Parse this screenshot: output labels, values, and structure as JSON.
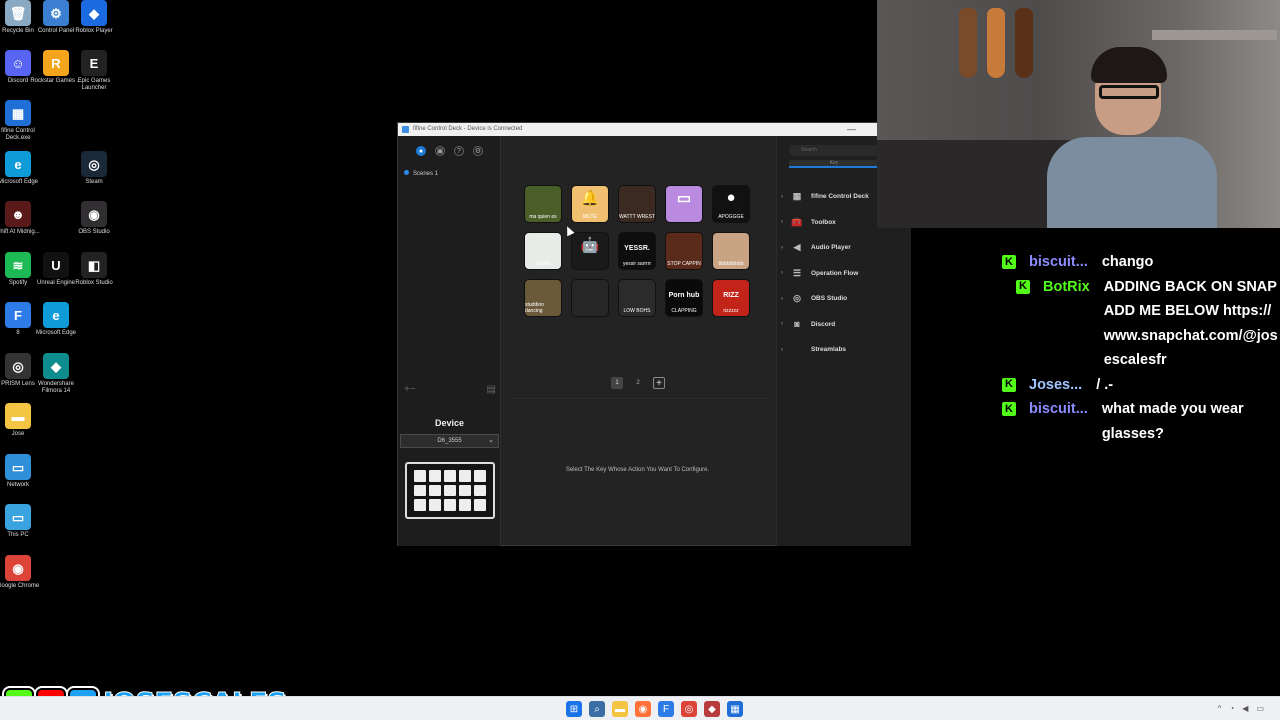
{
  "desktop": {
    "icons": [
      {
        "label": "Recycle Bin",
        "icon": "recycle-bin-icon",
        "color": "#8aa9c2",
        "glyph": "🗑"
      },
      {
        "label": "Control Panel",
        "icon": "control-panel-icon",
        "color": "#3b7fd1",
        "glyph": "⚙"
      },
      {
        "label": "Roblox Player",
        "icon": "roblox-icon",
        "color": "#1c6ae0",
        "glyph": "◆"
      },
      {
        "label": "Discord",
        "icon": "discord-icon",
        "color": "#5865f2",
        "glyph": "☺"
      },
      {
        "label": "Rockstar Games ...",
        "icon": "rockstar-icon",
        "color": "#f4a51c",
        "glyph": "R"
      },
      {
        "label": "Epic Games Launcher",
        "icon": "epic-games-icon",
        "color": "#222222",
        "glyph": "E"
      },
      {
        "label": "fifine Control Deck.exe",
        "icon": "fifine-icon",
        "color": "#1f6fd6",
        "glyph": "▦"
      },
      {
        "label": "Microsoft Edge",
        "icon": "edge-icon",
        "color": "#0f9bd7",
        "glyph": "e"
      },
      {
        "label": "Steam",
        "icon": "steam-icon",
        "color": "#1b2838",
        "glyph": "◎"
      },
      {
        "label": "Shift At Midnig...",
        "icon": "game-icon",
        "color": "#5a1a1a",
        "glyph": "☻"
      },
      {
        "label": "OBS Studio",
        "icon": "obs-icon",
        "color": "#302e31",
        "glyph": "◉"
      },
      {
        "label": "Spotify",
        "icon": "spotify-icon",
        "color": "#1db954",
        "glyph": "≋"
      },
      {
        "label": "Unreal Engine",
        "icon": "unreal-icon",
        "color": "#111111",
        "glyph": "U"
      },
      {
        "label": "Roblox Studio",
        "icon": "roblox-studio-icon",
        "color": "#222222",
        "glyph": "◧"
      },
      {
        "label": "8",
        "icon": "app-icon",
        "color": "#2d7be6",
        "glyph": "F"
      },
      {
        "label": "Microsoft Edge",
        "icon": "edge-icon",
        "color": "#0f9bd7",
        "glyph": "e"
      },
      {
        "label": "PRISM Lens",
        "icon": "prism-icon",
        "color": "#333333",
        "glyph": "◎"
      },
      {
        "label": "Wondershare Filmora 14",
        "icon": "filmora-icon",
        "color": "#0f8c8c",
        "glyph": "◆"
      },
      {
        "label": "Jose",
        "icon": "folder-icon",
        "color": "#f4c542",
        "glyph": "▬"
      },
      {
        "label": "Network",
        "icon": "network-icon",
        "color": "#2f8fd8",
        "glyph": "▭"
      },
      {
        "label": "This PC",
        "icon": "this-pc-icon",
        "color": "#3aa3e0",
        "glyph": "▭"
      },
      {
        "label": "Google Chrome",
        "icon": "chrome-icon",
        "color": "#db4437",
        "glyph": "◉"
      }
    ]
  },
  "app": {
    "title": "fifine Control Deck - Device is Connected",
    "minimize": "—",
    "scene_label": "Scenes 1",
    "device_label": "Device",
    "device_value": "D6_3555",
    "search_placeholder": "Search",
    "right_tab": "Key",
    "pages": [
      "1",
      "2",
      "+"
    ],
    "message": "Select The Key Whose Action You Want To Configure.",
    "keys": [
      {
        "label": "ma quien es",
        "icon": "shrek-image-icon",
        "color": "#4a5e2a",
        "glyph": ""
      },
      {
        "label": "MUTE",
        "icon": "bell-icon",
        "color": "#f0c070",
        "glyph": "🔔"
      },
      {
        "label": "WATTT WREST",
        "icon": "meme-image-icon",
        "color": "#3a2a22",
        "glyph": ""
      },
      {
        "label": "",
        "icon": "monitor-icon",
        "color": "#b98adf",
        "glyph": "▭"
      },
      {
        "label": "APOGGGE",
        "icon": "record-icon",
        "color": "#111111",
        "glyph": "●"
      },
      {
        "label": "fortnite",
        "icon": "meme-image-icon",
        "color": "#e8ece8",
        "glyph": ""
      },
      {
        "label": "",
        "icon": "android-icon",
        "color": "#1a1a1a",
        "glyph": "🤖"
      },
      {
        "label": "yessir sarrrrr",
        "icon": "yessir-text-icon",
        "color": "#0e0e0e",
        "glyph": "YESSR."
      },
      {
        "label": "STOP CAPPIN",
        "icon": "meme-image-icon",
        "color": "#5a2a1a",
        "glyph": ""
      },
      {
        "label": "bbbbbbbbb",
        "icon": "meme-image-icon",
        "color": "#c9a484",
        "glyph": ""
      },
      {
        "label": "studdioo dancing",
        "icon": "meme-image-icon",
        "color": "#6b5a3a",
        "glyph": ""
      },
      {
        "label": "",
        "icon": "empty-key-icon",
        "color": "#262626",
        "glyph": ""
      },
      {
        "label": "LOW BOHS",
        "icon": "meme-image-icon",
        "color": "#2b2b2b",
        "glyph": ""
      },
      {
        "label": "CLAPPING",
        "icon": "meme-image-icon",
        "color": "#0a0a0a",
        "glyph": "Porn hub"
      },
      {
        "label": "rizzzzz",
        "icon": "rizz-icon",
        "color": "#c2241a",
        "glyph": "RIZZ"
      }
    ],
    "plugins": [
      {
        "label": "fifine Control Deck",
        "icon": "grid-icon",
        "glyph": "▦"
      },
      {
        "label": "Toolbox",
        "icon": "toolbox-icon",
        "glyph": "🧰"
      },
      {
        "label": "Audio Player",
        "icon": "speaker-icon",
        "glyph": "◀"
      },
      {
        "label": "Operation Flow",
        "icon": "flow-icon",
        "glyph": "☰"
      },
      {
        "label": "OBS Studio",
        "icon": "obs-icon",
        "glyph": "◎"
      },
      {
        "label": "Discord",
        "icon": "discord-icon",
        "glyph": "◙"
      },
      {
        "label": "Streamlabs",
        "icon": "streamlabs-icon",
        "glyph": ""
      }
    ]
  },
  "chat": {
    "accent": "#53fc18",
    "messages": [
      {
        "user": "biscuit...",
        "color": "#8c8cff",
        "text": "chango"
      },
      {
        "user": "BotRix",
        "color": "#ffffff",
        "text": "ADDING BACK ON SNAP ADD ME BELOW https://www.snapchat.com/@josescalesfr"
      },
      {
        "user": "Joses...",
        "color": "#a0c4ff",
        "text": "/ .-"
      },
      {
        "user": "biscuit...",
        "color": "#8c8cff",
        "text": "what made you wear glasses?"
      }
    ]
  },
  "overlay": {
    "handle": "JOSESCALES",
    "kick": "K",
    "youtube": "▶",
    "twitter": "🐦"
  },
  "taskbar": {
    "icons": [
      {
        "name": "start-icon",
        "glyph": "⊞",
        "color": "#1a73e8"
      },
      {
        "name": "search-icon",
        "glyph": "⌕",
        "color": "#3a6ea5"
      },
      {
        "name": "file-explorer-icon",
        "glyph": "▬",
        "color": "#f4c542"
      },
      {
        "name": "firefox-icon",
        "glyph": "◉",
        "color": "#ff7139"
      },
      {
        "name": "fifine-icon",
        "glyph": "F",
        "color": "#2d7be6"
      },
      {
        "name": "chrome-icon",
        "glyph": "◎",
        "color": "#db4437"
      },
      {
        "name": "game-icon",
        "glyph": "◆",
        "color": "#b83b3b"
      },
      {
        "name": "fifine-deck-icon",
        "glyph": "▦",
        "color": "#1f6fd6"
      }
    ]
  }
}
